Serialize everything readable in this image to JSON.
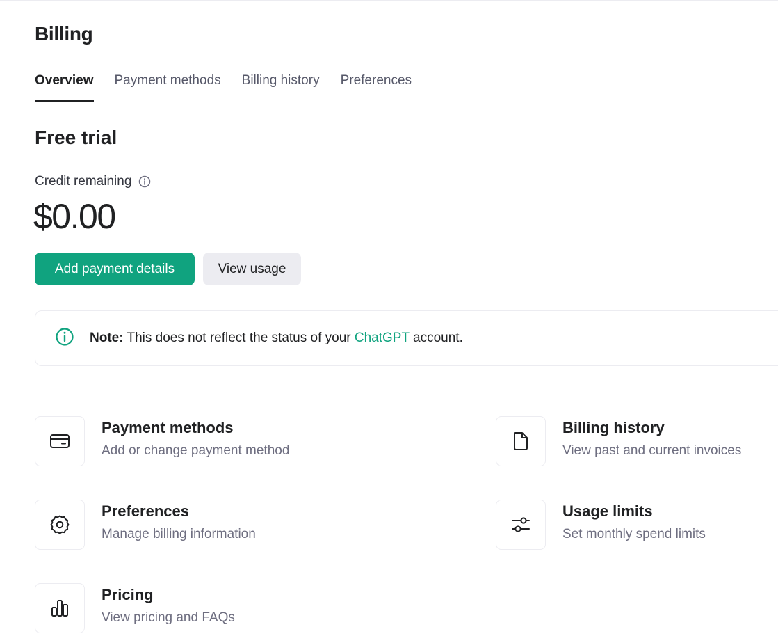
{
  "page": {
    "title": "Billing"
  },
  "tabs": [
    {
      "label": "Overview",
      "active": true
    },
    {
      "label": "Payment methods",
      "active": false
    },
    {
      "label": "Billing history",
      "active": false
    },
    {
      "label": "Preferences",
      "active": false
    }
  ],
  "plan": {
    "title": "Free trial",
    "credit_label": "Credit remaining",
    "credit_value": "$0.00"
  },
  "buttons": {
    "add_payment": "Add payment details",
    "view_usage": "View usage"
  },
  "note": {
    "prefix": "Note:",
    "text_before": " This does not reflect the status of your ",
    "link": "ChatGPT",
    "text_after": " account."
  },
  "cards": [
    {
      "title": "Payment methods",
      "desc": "Add or change payment method",
      "icon": "credit-card-icon"
    },
    {
      "title": "Billing history",
      "desc": "View past and current invoices",
      "icon": "document-icon"
    },
    {
      "title": "Preferences",
      "desc": "Manage billing information",
      "icon": "gear-icon"
    },
    {
      "title": "Usage limits",
      "desc": "Set monthly spend limits",
      "icon": "sliders-icon"
    },
    {
      "title": "Pricing",
      "desc": "View pricing and FAQs",
      "icon": "bar-chart-icon"
    }
  ],
  "colors": {
    "accent": "#10a37f",
    "text_primary": "#202123",
    "text_secondary": "#6e6e80",
    "border": "#ececf1"
  }
}
